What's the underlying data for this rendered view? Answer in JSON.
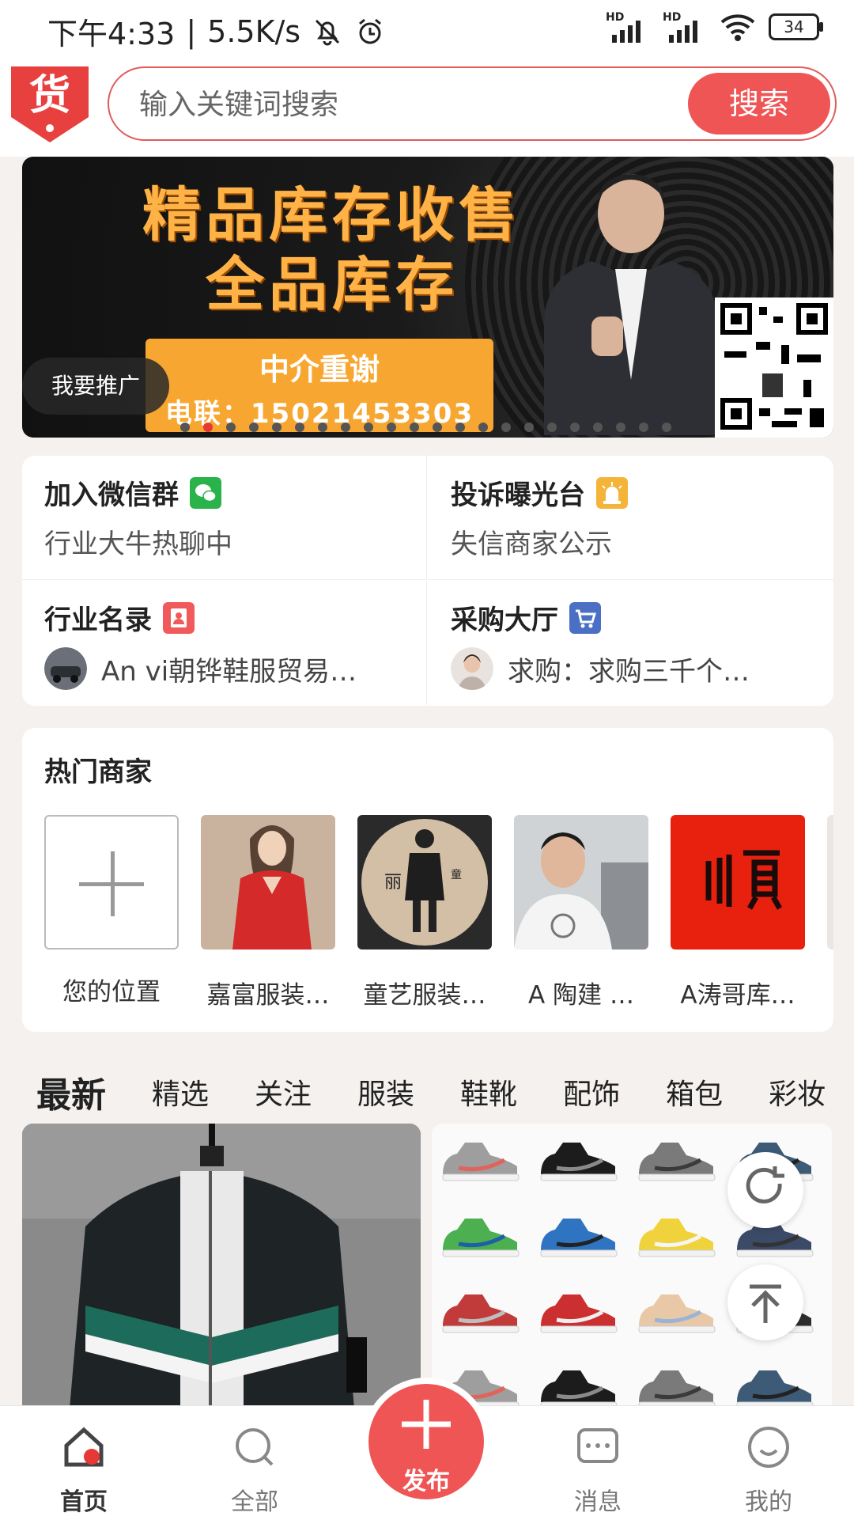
{
  "status_bar": {
    "time": "下午4:33",
    "speed": "5.5K/s",
    "battery": "34"
  },
  "search": {
    "placeholder": "输入关键词搜索",
    "button": "搜索"
  },
  "banner": {
    "title_line1": "精品库存收售",
    "title_line2": "全品库存",
    "contact_name": "中介重谢",
    "contact_phone": "电联：15021453303",
    "promo_tag": "我要推广",
    "page_count": 22,
    "active_index": 1
  },
  "quick_grid": [
    {
      "title": "加入微信群",
      "subtitle": "行业大牛热聊中",
      "icon": "wechat-icon",
      "color": "#29b34a"
    },
    {
      "title": "投诉曝光台",
      "subtitle": "失信商家公示",
      "icon": "alarm-icon",
      "color": "#f4b43a"
    },
    {
      "title": "行业名录",
      "subtitle": "An vi朝铧鞋服贸易…",
      "icon": "contact-card-icon",
      "color": "#f05a5a"
    },
    {
      "title": "采购大厅",
      "subtitle": "求购：求购三千个…",
      "icon": "cart-icon",
      "color": "#4a6fc4"
    }
  ],
  "merchants": {
    "title": "热门商家",
    "items": [
      {
        "label": "您的位置"
      },
      {
        "label": "嘉富服装…"
      },
      {
        "label": "童艺服装…"
      },
      {
        "label": "A 陶建 …"
      },
      {
        "label": "A涛哥库…"
      }
    ]
  },
  "tabs": [
    "最新",
    "精选",
    "关注",
    "服装",
    "鞋靴",
    "配饰",
    "箱包",
    "彩妆"
  ],
  "nav": {
    "home": "首页",
    "all": "全部",
    "publish": "发布",
    "messages": "消息",
    "mine": "我的"
  },
  "colors": {
    "brand": "#f05555",
    "active_dot": "#e53935"
  }
}
